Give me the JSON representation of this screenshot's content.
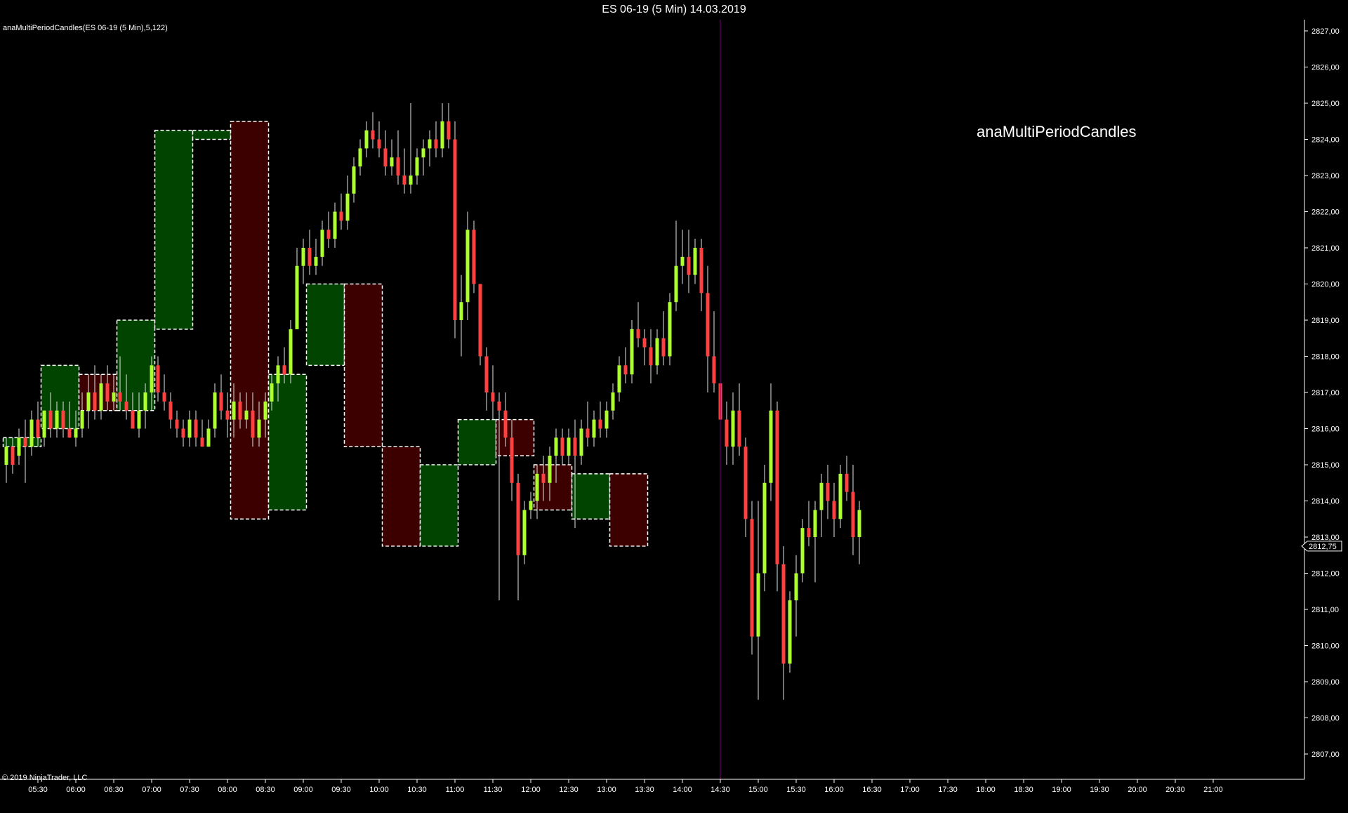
{
  "window": {
    "title": "ES 06-19 (5 Min)  14.03.2019"
  },
  "indicator_label": "anaMultiPeriodCandles(ES 06-19 (5 Min),5,122)",
  "watermark": "anaMultiPeriodCandles",
  "copyright": "© 2019 NinjaTrader, LLC",
  "current_price_label": "2812,75",
  "colors": {
    "background": "#000000",
    "up_wick": "#e6e6e6",
    "up_body": "#adff2f",
    "down_body": "#ff4040",
    "up_box_fill": "#004400",
    "down_box_fill": "#3d0000",
    "box_border": "#ffffff",
    "cursor_line": "#800080",
    "axis": "#ffffff"
  },
  "chart_data": {
    "type": "candlestick",
    "instrument": "ES 06-19",
    "interval": "5 Min",
    "date": "14.03.2019",
    "ylim": [
      2806.5,
      2827.25
    ],
    "y_ticks": [
      2807,
      2808,
      2809,
      2810,
      2811,
      2812,
      2813,
      2814,
      2815,
      2816,
      2817,
      2818,
      2819,
      2820,
      2821,
      2822,
      2823,
      2824,
      2825,
      2826,
      2827
    ],
    "y_tick_labels": [
      "2807,00",
      "2808,00",
      "2809,00",
      "2810,00",
      "2811,00",
      "2812,00",
      "2813,00",
      "2814,00",
      "2815,00",
      "2816,00",
      "2817,00",
      "2818,00",
      "2819,00",
      "2820,00",
      "2821,00",
      "2822,00",
      "2823,00",
      "2824,00",
      "2825,00",
      "2826,00",
      "2827,00"
    ],
    "x_ticks": [
      "05:30",
      "06:00",
      "06:30",
      "07:00",
      "07:30",
      "08:00",
      "08:30",
      "09:00",
      "09:30",
      "10:00",
      "10:30",
      "11:00",
      "11:30",
      "12:00",
      "12:30",
      "13:00",
      "13:30",
      "14:00",
      "14:30",
      "15:00",
      "15:30",
      "16:00",
      "16:30",
      "17:00",
      "17:30",
      "18:00",
      "18:30",
      "19:00",
      "19:30",
      "20:00",
      "20:30",
      "21:00"
    ],
    "first_bar_time": "05:05",
    "bar_minutes": 5,
    "cursor_time": "14:30",
    "current_price": 2812.75,
    "period_boxes": [
      {
        "start": "05:05",
        "end": "05:30",
        "open": 2815.5,
        "high": 2815.75,
        "low": 2815.5,
        "close": 2815.75
      },
      {
        "start": "05:35",
        "end": "06:00",
        "open": 2816.0,
        "high": 2817.75,
        "low": 2816.0,
        "close": 2817.75
      },
      {
        "start": "06:05",
        "end": "06:30",
        "open": 2817.5,
        "high": 2817.5,
        "low": 2816.5,
        "close": 2816.5
      },
      {
        "start": "06:35",
        "end": "07:00",
        "open": 2816.5,
        "high": 2819.0,
        "low": 2816.5,
        "close": 2819.0
      },
      {
        "start": "07:05",
        "end": "07:30",
        "open": 2818.75,
        "high": 2824.25,
        "low": 2818.75,
        "close": 2824.25
      },
      {
        "start": "07:35",
        "end": "08:00",
        "open": 2824.0,
        "high": 2824.25,
        "low": 2824.0,
        "close": 2824.25
      },
      {
        "start": "08:05",
        "end": "08:30",
        "open": 2824.5,
        "high": 2824.5,
        "low": 2813.5,
        "close": 2813.5
      },
      {
        "start": "08:35",
        "end": "09:00",
        "open": 2813.75,
        "high": 2817.5,
        "low": 2813.75,
        "close": 2817.5
      },
      {
        "start": "09:05",
        "end": "09:30",
        "open": 2817.75,
        "high": 2820.0,
        "low": 2817.75,
        "close": 2820.0
      },
      {
        "start": "09:35",
        "end": "10:00",
        "open": 2820.0,
        "high": 2820.0,
        "low": 2815.5,
        "close": 2815.5
      },
      {
        "start": "10:05",
        "end": "10:30",
        "open": 2815.5,
        "high": 2815.5,
        "low": 2812.75,
        "close": 2812.75
      },
      {
        "start": "10:35",
        "end": "11:00",
        "open": 2812.75,
        "high": 2815.0,
        "low": 2812.75,
        "close": 2815.0
      },
      {
        "start": "11:05",
        "end": "11:30",
        "open": 2815.0,
        "high": 2816.25,
        "low": 2815.0,
        "close": 2816.25
      },
      {
        "start": "11:35",
        "end": "12:00",
        "open": 2816.25,
        "high": 2816.25,
        "low": 2815.25,
        "close": 2815.25
      },
      {
        "start": "12:05",
        "end": "12:30",
        "open": 2815.0,
        "high": 2815.0,
        "low": 2813.75,
        "close": 2813.75
      },
      {
        "start": "12:35",
        "end": "13:00",
        "open": 2813.5,
        "high": 2814.75,
        "low": 2813.5,
        "close": 2814.75
      },
      {
        "start": "13:05",
        "end": "13:30",
        "open": 2814.75,
        "high": 2814.75,
        "low": 2812.75,
        "close": 2812.75
      }
    ],
    "candles": [
      {
        "o": 2815.0,
        "h": 2815.75,
        "l": 2814.5,
        "c": 2815.5
      },
      {
        "o": 2815.5,
        "h": 2815.75,
        "l": 2814.75,
        "c": 2815.0
      },
      {
        "o": 2815.25,
        "h": 2816.0,
        "l": 2815.0,
        "c": 2815.75
      },
      {
        "o": 2815.75,
        "h": 2816.25,
        "l": 2814.5,
        "c": 2815.5
      },
      {
        "o": 2815.5,
        "h": 2816.5,
        "l": 2815.25,
        "c": 2816.25
      },
      {
        "o": 2816.25,
        "h": 2816.75,
        "l": 2815.5,
        "c": 2815.75
      },
      {
        "o": 2815.75,
        "h": 2816.5,
        "l": 2815.5,
        "c": 2816.5
      },
      {
        "o": 2816.5,
        "h": 2817.0,
        "l": 2815.75,
        "c": 2816.0
      },
      {
        "o": 2816.0,
        "h": 2816.75,
        "l": 2815.75,
        "c": 2816.5
      },
      {
        "o": 2816.5,
        "h": 2816.75,
        "l": 2815.75,
        "c": 2816.0
      },
      {
        "o": 2816.0,
        "h": 2816.75,
        "l": 2815.75,
        "c": 2815.75
      },
      {
        "o": 2815.75,
        "h": 2816.5,
        "l": 2815.5,
        "c": 2816.0
      },
      {
        "o": 2816.0,
        "h": 2817.0,
        "l": 2815.75,
        "c": 2816.5
      },
      {
        "o": 2816.5,
        "h": 2817.5,
        "l": 2816.0,
        "c": 2817.0
      },
      {
        "o": 2817.0,
        "h": 2817.75,
        "l": 2816.25,
        "c": 2816.5
      },
      {
        "o": 2816.5,
        "h": 2817.5,
        "l": 2816.25,
        "c": 2817.25
      },
      {
        "o": 2817.25,
        "h": 2817.75,
        "l": 2816.5,
        "c": 2816.75
      },
      {
        "o": 2816.75,
        "h": 2817.5,
        "l": 2816.5,
        "c": 2817.0
      },
      {
        "o": 2817.0,
        "h": 2818.0,
        "l": 2816.5,
        "c": 2816.75
      },
      {
        "o": 2816.75,
        "h": 2817.5,
        "l": 2816.25,
        "c": 2816.5
      },
      {
        "o": 2816.5,
        "h": 2817.0,
        "l": 2816.0,
        "c": 2816.0
      },
      {
        "o": 2816.0,
        "h": 2817.0,
        "l": 2815.75,
        "c": 2816.5
      },
      {
        "o": 2816.5,
        "h": 2817.25,
        "l": 2816.0,
        "c": 2817.0
      },
      {
        "o": 2817.0,
        "h": 2818.0,
        "l": 2816.5,
        "c": 2817.75
      },
      {
        "o": 2817.75,
        "h": 2818.0,
        "l": 2816.75,
        "c": 2817.0
      },
      {
        "o": 2817.0,
        "h": 2817.5,
        "l": 2816.5,
        "c": 2816.75
      },
      {
        "o": 2816.75,
        "h": 2817.0,
        "l": 2816.0,
        "c": 2816.25
      },
      {
        "o": 2816.25,
        "h": 2816.5,
        "l": 2815.75,
        "c": 2816.0
      },
      {
        "o": 2816.0,
        "h": 2816.25,
        "l": 2815.5,
        "c": 2815.75
      },
      {
        "o": 2815.75,
        "h": 2816.5,
        "l": 2815.5,
        "c": 2816.25
      },
      {
        "o": 2816.25,
        "h": 2816.5,
        "l": 2815.5,
        "c": 2815.75
      },
      {
        "o": 2815.75,
        "h": 2816.25,
        "l": 2815.5,
        "c": 2815.5
      },
      {
        "o": 2815.5,
        "h": 2816.25,
        "l": 2815.5,
        "c": 2816.0
      },
      {
        "o": 2816.0,
        "h": 2817.25,
        "l": 2815.75,
        "c": 2817.0
      },
      {
        "o": 2817.0,
        "h": 2817.5,
        "l": 2816.25,
        "c": 2816.5
      },
      {
        "o": 2816.5,
        "h": 2817.0,
        "l": 2815.75,
        "c": 2816.25
      },
      {
        "o": 2816.25,
        "h": 2817.25,
        "l": 2815.75,
        "c": 2816.75
      },
      {
        "o": 2816.75,
        "h": 2817.0,
        "l": 2816.0,
        "c": 2816.25
      },
      {
        "o": 2816.25,
        "h": 2817.0,
        "l": 2816.0,
        "c": 2816.5
      },
      {
        "o": 2816.5,
        "h": 2817.0,
        "l": 2815.5,
        "c": 2815.75
      },
      {
        "o": 2815.75,
        "h": 2816.75,
        "l": 2815.5,
        "c": 2816.25
      },
      {
        "o": 2816.25,
        "h": 2817.0,
        "l": 2815.75,
        "c": 2816.75
      },
      {
        "o": 2816.75,
        "h": 2817.5,
        "l": 2816.5,
        "c": 2817.25
      },
      {
        "o": 2817.25,
        "h": 2818.0,
        "l": 2816.75,
        "c": 2817.75
      },
      {
        "o": 2817.75,
        "h": 2818.25,
        "l": 2817.25,
        "c": 2817.5
      },
      {
        "o": 2817.5,
        "h": 2819.0,
        "l": 2817.25,
        "c": 2818.75
      },
      {
        "o": 2818.75,
        "h": 2821.0,
        "l": 2818.75,
        "c": 2820.5
      },
      {
        "o": 2820.5,
        "h": 2821.25,
        "l": 2820.0,
        "c": 2821.0
      },
      {
        "o": 2821.0,
        "h": 2821.5,
        "l": 2820.25,
        "c": 2820.5
      },
      {
        "o": 2820.5,
        "h": 2821.25,
        "l": 2820.25,
        "c": 2820.75
      },
      {
        "o": 2820.75,
        "h": 2821.75,
        "l": 2820.5,
        "c": 2821.5
      },
      {
        "o": 2821.5,
        "h": 2822.0,
        "l": 2821.0,
        "c": 2821.25
      },
      {
        "o": 2821.25,
        "h": 2822.25,
        "l": 2821.0,
        "c": 2822.0
      },
      {
        "o": 2822.0,
        "h": 2822.5,
        "l": 2821.5,
        "c": 2821.75
      },
      {
        "o": 2821.75,
        "h": 2823.0,
        "l": 2821.5,
        "c": 2822.5
      },
      {
        "o": 2822.5,
        "h": 2823.5,
        "l": 2822.25,
        "c": 2823.25
      },
      {
        "o": 2823.25,
        "h": 2824.0,
        "l": 2823.0,
        "c": 2823.75
      },
      {
        "o": 2823.75,
        "h": 2824.5,
        "l": 2823.5,
        "c": 2824.25
      },
      {
        "o": 2824.25,
        "h": 2824.75,
        "l": 2823.75,
        "c": 2824.0
      },
      {
        "o": 2824.0,
        "h": 2824.5,
        "l": 2823.5,
        "c": 2823.75
      },
      {
        "o": 2823.75,
        "h": 2824.25,
        "l": 2823.0,
        "c": 2823.25
      },
      {
        "o": 2823.25,
        "h": 2824.0,
        "l": 2823.0,
        "c": 2823.5
      },
      {
        "o": 2823.5,
        "h": 2824.25,
        "l": 2822.75,
        "c": 2823.0
      },
      {
        "o": 2823.0,
        "h": 2823.75,
        "l": 2822.5,
        "c": 2822.75
      },
      {
        "o": 2822.75,
        "h": 2825.0,
        "l": 2822.5,
        "c": 2823.0
      },
      {
        "o": 2823.0,
        "h": 2823.75,
        "l": 2822.75,
        "c": 2823.5
      },
      {
        "o": 2823.5,
        "h": 2824.0,
        "l": 2823.0,
        "c": 2823.75
      },
      {
        "o": 2823.75,
        "h": 2824.25,
        "l": 2823.25,
        "c": 2824.0
      },
      {
        "o": 2824.0,
        "h": 2824.5,
        "l": 2823.5,
        "c": 2823.75
      },
      {
        "o": 2823.75,
        "h": 2825.0,
        "l": 2823.5,
        "c": 2824.5
      },
      {
        "o": 2824.5,
        "h": 2825.0,
        "l": 2823.75,
        "c": 2824.0
      },
      {
        "o": 2824.0,
        "h": 2824.5,
        "l": 2818.5,
        "c": 2819.0
      },
      {
        "o": 2819.0,
        "h": 2820.25,
        "l": 2818.0,
        "c": 2819.5
      },
      {
        "o": 2819.5,
        "h": 2822.0,
        "l": 2819.0,
        "c": 2821.5
      },
      {
        "o": 2821.5,
        "h": 2821.75,
        "l": 2819.75,
        "c": 2820.0
      },
      {
        "o": 2820.0,
        "h": 2820.0,
        "l": 2817.75,
        "c": 2818.0
      },
      {
        "o": 2818.0,
        "h": 2818.25,
        "l": 2816.5,
        "c": 2817.0
      },
      {
        "o": 2817.0,
        "h": 2817.75,
        "l": 2816.25,
        "c": 2816.75
      },
      {
        "o": 2816.75,
        "h": 2817.0,
        "l": 2811.25,
        "c": 2816.5
      },
      {
        "o": 2816.5,
        "h": 2817.0,
        "l": 2815.5,
        "c": 2815.75
      },
      {
        "o": 2815.75,
        "h": 2816.25,
        "l": 2814.0,
        "c": 2814.5
      },
      {
        "o": 2814.5,
        "h": 2814.75,
        "l": 2811.25,
        "c": 2812.5
      },
      {
        "o": 2812.5,
        "h": 2814.0,
        "l": 2812.25,
        "c": 2813.75
      },
      {
        "o": 2813.75,
        "h": 2814.25,
        "l": 2813.5,
        "c": 2814.0
      },
      {
        "o": 2814.0,
        "h": 2815.0,
        "l": 2813.5,
        "c": 2814.75
      },
      {
        "o": 2814.75,
        "h": 2815.25,
        "l": 2814.0,
        "c": 2814.5
      },
      {
        "o": 2814.5,
        "h": 2815.5,
        "l": 2814.0,
        "c": 2815.25
      },
      {
        "o": 2815.25,
        "h": 2816.0,
        "l": 2814.5,
        "c": 2815.75
      },
      {
        "o": 2815.75,
        "h": 2816.0,
        "l": 2815.0,
        "c": 2815.25
      },
      {
        "o": 2815.25,
        "h": 2816.0,
        "l": 2815.0,
        "c": 2815.75
      },
      {
        "o": 2815.75,
        "h": 2816.25,
        "l": 2813.25,
        "c": 2815.25
      },
      {
        "o": 2815.25,
        "h": 2816.25,
        "l": 2815.0,
        "c": 2816.0
      },
      {
        "o": 2816.0,
        "h": 2816.75,
        "l": 2815.5,
        "c": 2815.75
      },
      {
        "o": 2815.75,
        "h": 2816.5,
        "l": 2815.5,
        "c": 2816.25
      },
      {
        "o": 2816.25,
        "h": 2816.75,
        "l": 2815.75,
        "c": 2816.0
      },
      {
        "o": 2816.0,
        "h": 2816.75,
        "l": 2815.75,
        "c": 2816.5
      },
      {
        "o": 2816.5,
        "h": 2817.25,
        "l": 2816.25,
        "c": 2817.0
      },
      {
        "o": 2817.0,
        "h": 2818.0,
        "l": 2816.75,
        "c": 2817.75
      },
      {
        "o": 2817.75,
        "h": 2818.25,
        "l": 2817.25,
        "c": 2817.5
      },
      {
        "o": 2817.5,
        "h": 2819.0,
        "l": 2817.25,
        "c": 2818.75
      },
      {
        "o": 2818.75,
        "h": 2819.5,
        "l": 2818.25,
        "c": 2818.5
      },
      {
        "o": 2818.5,
        "h": 2818.75,
        "l": 2817.75,
        "c": 2818.25
      },
      {
        "o": 2818.25,
        "h": 2818.75,
        "l": 2817.25,
        "c": 2817.75
      },
      {
        "o": 2817.75,
        "h": 2818.75,
        "l": 2817.5,
        "c": 2818.5
      },
      {
        "o": 2818.5,
        "h": 2819.25,
        "l": 2817.75,
        "c": 2818.0
      },
      {
        "o": 2818.0,
        "h": 2819.75,
        "l": 2817.75,
        "c": 2819.5
      },
      {
        "o": 2819.5,
        "h": 2821.75,
        "l": 2819.25,
        "c": 2820.5
      },
      {
        "o": 2820.5,
        "h": 2821.5,
        "l": 2820.0,
        "c": 2820.75
      },
      {
        "o": 2820.75,
        "h": 2821.5,
        "l": 2819.75,
        "c": 2820.25
      },
      {
        "o": 2820.25,
        "h": 2821.25,
        "l": 2820.0,
        "c": 2821.0
      },
      {
        "o": 2821.0,
        "h": 2821.25,
        "l": 2819.25,
        "c": 2819.75
      },
      {
        "o": 2819.75,
        "h": 2820.5,
        "l": 2817.0,
        "c": 2818.0
      },
      {
        "o": 2818.0,
        "h": 2819.25,
        "l": 2817.0,
        "c": 2817.25
      },
      {
        "o": 2817.25,
        "h": 2818.0,
        "l": 2816.0,
        "c": 2816.25
      },
      {
        "o": 2816.25,
        "h": 2816.75,
        "l": 2815.0,
        "c": 2815.5
      },
      {
        "o": 2815.5,
        "h": 2817.0,
        "l": 2815.0,
        "c": 2816.5
      },
      {
        "o": 2816.5,
        "h": 2817.25,
        "l": 2815.25,
        "c": 2815.5
      },
      {
        "o": 2815.5,
        "h": 2815.75,
        "l": 2813.0,
        "c": 2813.5
      },
      {
        "o": 2813.5,
        "h": 2814.0,
        "l": 2809.75,
        "c": 2810.25
      },
      {
        "o": 2810.25,
        "h": 2814.0,
        "l": 2808.5,
        "c": 2812.0
      },
      {
        "o": 2812.0,
        "h": 2815.0,
        "l": 2811.5,
        "c": 2814.5
      },
      {
        "o": 2814.5,
        "h": 2817.25,
        "l": 2814.0,
        "c": 2816.5
      },
      {
        "o": 2816.5,
        "h": 2816.75,
        "l": 2811.5,
        "c": 2812.25
      },
      {
        "o": 2812.25,
        "h": 2812.75,
        "l": 2808.5,
        "c": 2809.5
      },
      {
        "o": 2809.5,
        "h": 2811.5,
        "l": 2809.25,
        "c": 2811.25
      },
      {
        "o": 2811.25,
        "h": 2812.5,
        "l": 2810.25,
        "c": 2812.0
      },
      {
        "o": 2812.0,
        "h": 2813.5,
        "l": 2811.75,
        "c": 2813.25
      },
      {
        "o": 2813.25,
        "h": 2814.0,
        "l": 2812.75,
        "c": 2813.0
      },
      {
        "o": 2813.0,
        "h": 2814.0,
        "l": 2811.75,
        "c": 2813.75
      },
      {
        "o": 2813.75,
        "h": 2814.75,
        "l": 2813.0,
        "c": 2814.5
      },
      {
        "o": 2814.5,
        "h": 2815.0,
        "l": 2813.5,
        "c": 2814.0
      },
      {
        "o": 2814.0,
        "h": 2814.5,
        "l": 2813.0,
        "c": 2813.5
      },
      {
        "o": 2813.5,
        "h": 2815.0,
        "l": 2813.25,
        "c": 2814.75
      },
      {
        "o": 2814.75,
        "h": 2815.25,
        "l": 2814.0,
        "c": 2814.25
      },
      {
        "o": 2814.25,
        "h": 2815.0,
        "l": 2812.5,
        "c": 2813.0
      },
      {
        "o": 2813.0,
        "h": 2814.0,
        "l": 2812.25,
        "c": 2813.75
      }
    ]
  }
}
